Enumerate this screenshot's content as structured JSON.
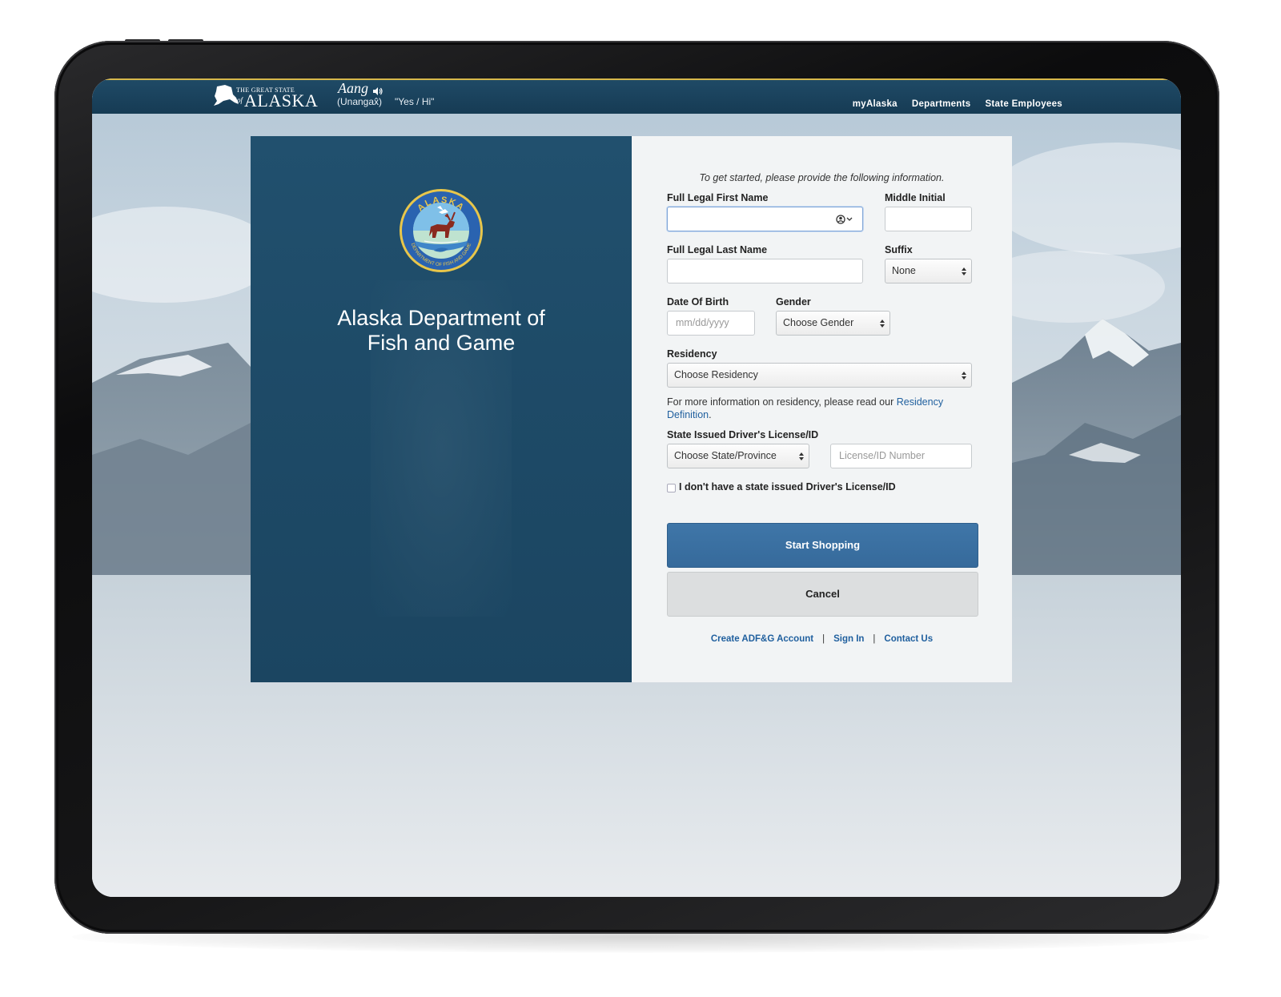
{
  "header": {
    "logo_small": "THE GREAT STATE",
    "logo_of": "of",
    "logo_name": "ALASKA",
    "native_word": "Aang",
    "native_language": "(Unangax̂)",
    "native_translation": "\"Yes / Hi\"",
    "nav": [
      "myAlaska",
      "Departments",
      "State Employees"
    ]
  },
  "left": {
    "seal_top_text": "ALASKA",
    "seal_ring_text": "DEPARTMENT OF FISH AND GAME",
    "title_line1": "Alaska Department of",
    "title_line2": "Fish and Game"
  },
  "form": {
    "intro": "To get started, please provide the following information.",
    "first_name": {
      "label": "Full Legal First Name",
      "value": ""
    },
    "middle_initial": {
      "label": "Middle Initial",
      "value": ""
    },
    "last_name": {
      "label": "Full Legal Last Name",
      "value": ""
    },
    "suffix": {
      "label": "Suffix",
      "selected": "None"
    },
    "dob": {
      "label": "Date Of Birth",
      "placeholder": "mm/dd/yyyy"
    },
    "gender": {
      "label": "Gender",
      "selected": "Choose Gender"
    },
    "residency": {
      "label": "Residency",
      "selected": "Choose Residency"
    },
    "residency_help": "For more information on residency, please read our ",
    "residency_link": "Residency Definition",
    "residency_help_end": ".",
    "license": {
      "label": "State Issued Driver's License/ID",
      "state_selected": "Choose State/Province",
      "number_placeholder": "License/ID Number"
    },
    "no_license_label": "I don't have a state issued Driver's License/ID",
    "start_button": "Start Shopping",
    "cancel_button": "Cancel",
    "footer_links": [
      "Create ADF&G Account",
      "Sign In",
      "Contact Us"
    ],
    "footer_separator": "|"
  },
  "colors": {
    "header_bg": "#1f4a66",
    "header_accent": "#d7b84b",
    "panel_blue": "#1e4b68",
    "primary_button": "#3a70a2",
    "link": "#1f5f9e"
  }
}
